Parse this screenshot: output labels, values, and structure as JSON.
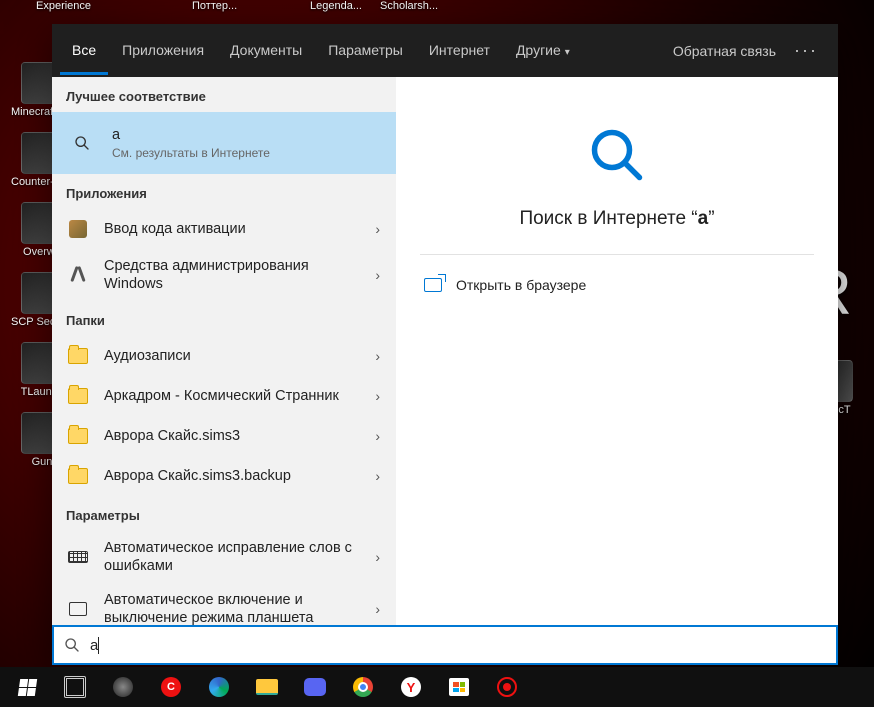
{
  "top_labels": {
    "l1": "Experience",
    "l2": "Поттер...",
    "l3": "Legenda...",
    "l4": "Scholarsh..."
  },
  "big_letter": "R",
  "desk_left": [
    "Minecraft Story M",
    "Counter-Source",
    "Overwa",
    "SCP Secret Laborat",
    "TLaunch",
    "Gun"
  ],
  "desk_right": [
    "atYOcT"
  ],
  "tabs": {
    "all": "Все",
    "apps": "Приложения",
    "docs": "Документы",
    "settings": "Параметры",
    "web": "Интернет",
    "other": "Другие"
  },
  "feedback": "Обратная связь",
  "sections": {
    "best": "Лучшее соответствие",
    "apps": "Приложения",
    "folders": "Папки",
    "settings": "Параметры"
  },
  "best": {
    "title": "a",
    "sub": "См. результаты в Интернете"
  },
  "apps": [
    {
      "title": "Ввод кода активации"
    },
    {
      "title": "Средства администрирования Windows"
    }
  ],
  "folders": [
    {
      "title": "Аудиозаписи"
    },
    {
      "title": "Аркадром - Космический Странник"
    },
    {
      "title": "Аврора Скайс.sims3"
    },
    {
      "title": "Аврора Скайс.sims3.backup"
    }
  ],
  "settings_items": [
    {
      "title": "Автоматическое исправление слов с ошибками"
    },
    {
      "title": "Автоматическое включение и выключение режима планшета"
    }
  ],
  "preview": {
    "prefix": "Поиск в Интернете ",
    "quote_open": "“",
    "term": "a",
    "quote_close": "”"
  },
  "actions": {
    "open_browser": "Открыть в браузере"
  },
  "search_value": "a"
}
